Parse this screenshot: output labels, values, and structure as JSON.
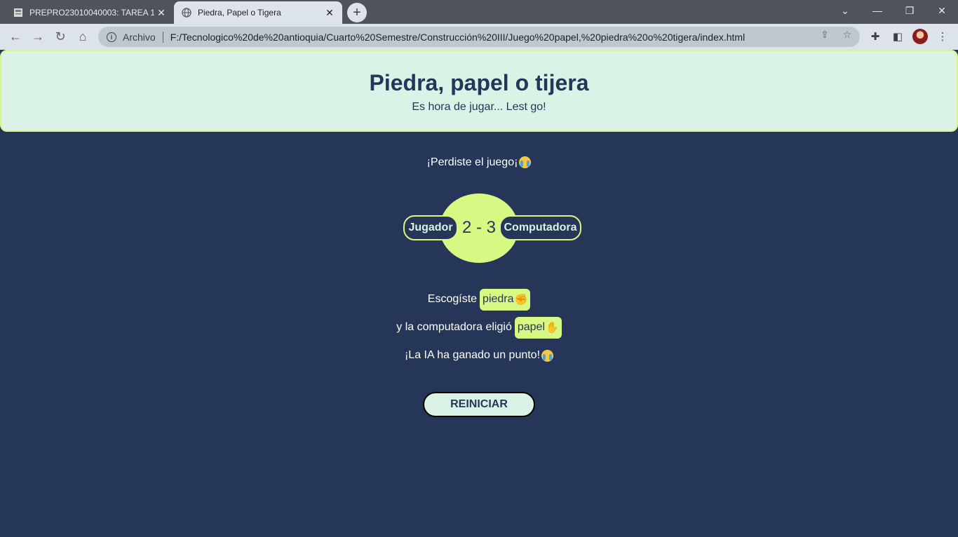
{
  "browser": {
    "tabs": [
      {
        "title": "PREPRO23010040003: TAREA 1",
        "active": false
      },
      {
        "title": "Piedra, Papel o Tigera",
        "active": true
      }
    ],
    "new_tab_label": "+",
    "address_bar": {
      "scheme_label": "Archivo",
      "url": "F:/Tecnologico%20de%20antioquia/Cuarto%20Semestre/Construcción%20III/Juego%20papel,%20piedra%20o%20tigera/index.html"
    },
    "colors": {
      "tabstrip": "#4f545c",
      "toolbar": "#dde3ea"
    }
  },
  "page": {
    "title": "Piedra, papel o tijera",
    "subtitle": "Es hora de jugar... Lest go!",
    "result_message": "¡Perdiste el juego¡",
    "score": {
      "player_label": "Jugador",
      "computer_label": "Computadora",
      "text": "2 - 3",
      "player": 2,
      "computer": 3
    },
    "player_choice": {
      "prefix": "Escogíste",
      "value": "piedra",
      "icon": "fist-emoji"
    },
    "computer_choice": {
      "prefix": "y la computadora eligió",
      "value": "papel",
      "icon": "raised-hand-emoji"
    },
    "round_message": "¡La IA ha ganado un punto!",
    "reset_label": "REINICIAR",
    "colors": {
      "background": "#253659",
      "header": "#daf3e6",
      "accent": "#d8f884",
      "text_dark": "#253659"
    }
  }
}
